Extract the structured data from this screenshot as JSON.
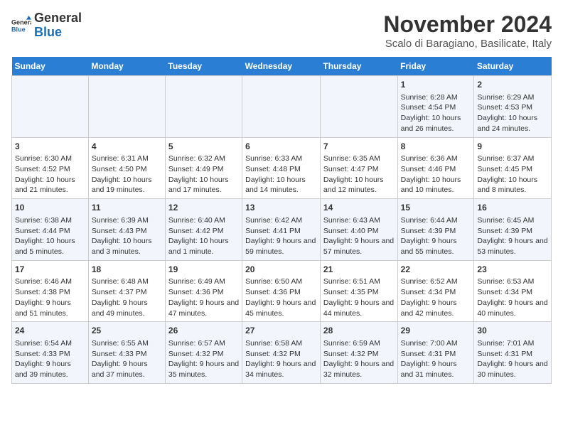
{
  "logo": {
    "general": "General",
    "blue": "Blue"
  },
  "title": "November 2024",
  "subtitle": "Scalo di Baragiano, Basilicate, Italy",
  "days_of_week": [
    "Sunday",
    "Monday",
    "Tuesday",
    "Wednesday",
    "Thursday",
    "Friday",
    "Saturday"
  ],
  "weeks": [
    [
      {
        "day": "",
        "info": ""
      },
      {
        "day": "",
        "info": ""
      },
      {
        "day": "",
        "info": ""
      },
      {
        "day": "",
        "info": ""
      },
      {
        "day": "",
        "info": ""
      },
      {
        "day": "1",
        "info": "Sunrise: 6:28 AM\nSunset: 4:54 PM\nDaylight: 10 hours and 26 minutes."
      },
      {
        "day": "2",
        "info": "Sunrise: 6:29 AM\nSunset: 4:53 PM\nDaylight: 10 hours and 24 minutes."
      }
    ],
    [
      {
        "day": "3",
        "info": "Sunrise: 6:30 AM\nSunset: 4:52 PM\nDaylight: 10 hours and 21 minutes."
      },
      {
        "day": "4",
        "info": "Sunrise: 6:31 AM\nSunset: 4:50 PM\nDaylight: 10 hours and 19 minutes."
      },
      {
        "day": "5",
        "info": "Sunrise: 6:32 AM\nSunset: 4:49 PM\nDaylight: 10 hours and 17 minutes."
      },
      {
        "day": "6",
        "info": "Sunrise: 6:33 AM\nSunset: 4:48 PM\nDaylight: 10 hours and 14 minutes."
      },
      {
        "day": "7",
        "info": "Sunrise: 6:35 AM\nSunset: 4:47 PM\nDaylight: 10 hours and 12 minutes."
      },
      {
        "day": "8",
        "info": "Sunrise: 6:36 AM\nSunset: 4:46 PM\nDaylight: 10 hours and 10 minutes."
      },
      {
        "day": "9",
        "info": "Sunrise: 6:37 AM\nSunset: 4:45 PM\nDaylight: 10 hours and 8 minutes."
      }
    ],
    [
      {
        "day": "10",
        "info": "Sunrise: 6:38 AM\nSunset: 4:44 PM\nDaylight: 10 hours and 5 minutes."
      },
      {
        "day": "11",
        "info": "Sunrise: 6:39 AM\nSunset: 4:43 PM\nDaylight: 10 hours and 3 minutes."
      },
      {
        "day": "12",
        "info": "Sunrise: 6:40 AM\nSunset: 4:42 PM\nDaylight: 10 hours and 1 minute."
      },
      {
        "day": "13",
        "info": "Sunrise: 6:42 AM\nSunset: 4:41 PM\nDaylight: 9 hours and 59 minutes."
      },
      {
        "day": "14",
        "info": "Sunrise: 6:43 AM\nSunset: 4:40 PM\nDaylight: 9 hours and 57 minutes."
      },
      {
        "day": "15",
        "info": "Sunrise: 6:44 AM\nSunset: 4:39 PM\nDaylight: 9 hours and 55 minutes."
      },
      {
        "day": "16",
        "info": "Sunrise: 6:45 AM\nSunset: 4:39 PM\nDaylight: 9 hours and 53 minutes."
      }
    ],
    [
      {
        "day": "17",
        "info": "Sunrise: 6:46 AM\nSunset: 4:38 PM\nDaylight: 9 hours and 51 minutes."
      },
      {
        "day": "18",
        "info": "Sunrise: 6:48 AM\nSunset: 4:37 PM\nDaylight: 9 hours and 49 minutes."
      },
      {
        "day": "19",
        "info": "Sunrise: 6:49 AM\nSunset: 4:36 PM\nDaylight: 9 hours and 47 minutes."
      },
      {
        "day": "20",
        "info": "Sunrise: 6:50 AM\nSunset: 4:36 PM\nDaylight: 9 hours and 45 minutes."
      },
      {
        "day": "21",
        "info": "Sunrise: 6:51 AM\nSunset: 4:35 PM\nDaylight: 9 hours and 44 minutes."
      },
      {
        "day": "22",
        "info": "Sunrise: 6:52 AM\nSunset: 4:34 PM\nDaylight: 9 hours and 42 minutes."
      },
      {
        "day": "23",
        "info": "Sunrise: 6:53 AM\nSunset: 4:34 PM\nDaylight: 9 hours and 40 minutes."
      }
    ],
    [
      {
        "day": "24",
        "info": "Sunrise: 6:54 AM\nSunset: 4:33 PM\nDaylight: 9 hours and 39 minutes."
      },
      {
        "day": "25",
        "info": "Sunrise: 6:55 AM\nSunset: 4:33 PM\nDaylight: 9 hours and 37 minutes."
      },
      {
        "day": "26",
        "info": "Sunrise: 6:57 AM\nSunset: 4:32 PM\nDaylight: 9 hours and 35 minutes."
      },
      {
        "day": "27",
        "info": "Sunrise: 6:58 AM\nSunset: 4:32 PM\nDaylight: 9 hours and 34 minutes."
      },
      {
        "day": "28",
        "info": "Sunrise: 6:59 AM\nSunset: 4:32 PM\nDaylight: 9 hours and 32 minutes."
      },
      {
        "day": "29",
        "info": "Sunrise: 7:00 AM\nSunset: 4:31 PM\nDaylight: 9 hours and 31 minutes."
      },
      {
        "day": "30",
        "info": "Sunrise: 7:01 AM\nSunset: 4:31 PM\nDaylight: 9 hours and 30 minutes."
      }
    ]
  ]
}
